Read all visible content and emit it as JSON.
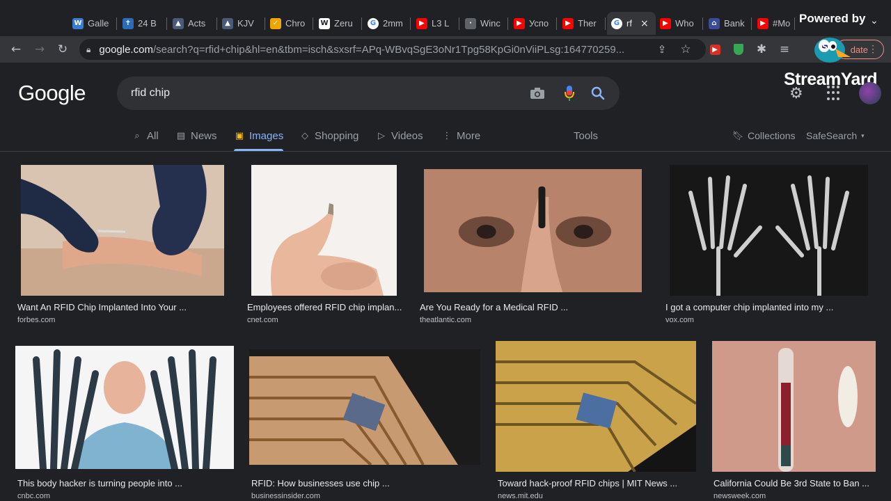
{
  "browser": {
    "tabs": [
      {
        "label": "Galle",
        "favicon": "wordpress-icon",
        "color": "#3a7bd5",
        "glyph": "W"
      },
      {
        "label": "24 B",
        "favicon": "bible-cross-icon",
        "color": "#2a6cb8",
        "glyph": "✝"
      },
      {
        "label": "Acts",
        "favicon": "bible-app-icon",
        "color": "#4a5a7a",
        "glyph": "▲"
      },
      {
        "label": "KJV",
        "favicon": "bible-app-icon",
        "color": "#4a5a7a",
        "glyph": "▲"
      },
      {
        "label": "Chro",
        "favicon": "check-app-icon",
        "color": "#f0a500",
        "glyph": "✓"
      },
      {
        "label": "Zeru",
        "favicon": "wikipedia-icon",
        "color": "#ffffff",
        "glyph": "W"
      },
      {
        "label": "2mm",
        "favicon": "google-icon",
        "color": "#ffffff",
        "glyph": "G"
      },
      {
        "label": "L3 L",
        "favicon": "youtube-icon",
        "color": "#ff0000",
        "glyph": "▶"
      },
      {
        "label": "Winc",
        "favicon": "dots-icon",
        "color": "#5f6368",
        "glyph": "·"
      },
      {
        "label": "Успо",
        "favicon": "youtube-icon",
        "color": "#ff0000",
        "glyph": "▶"
      },
      {
        "label": "Ther",
        "favicon": "youtube-icon",
        "color": "#ff0000",
        "glyph": "▶"
      },
      {
        "label": "rf",
        "favicon": "google-icon",
        "color": "#ffffff",
        "glyph": "G",
        "active": true
      },
      {
        "label": "Who",
        "favicon": "youtube-icon",
        "color": "#ff0000",
        "glyph": "▶"
      },
      {
        "label": "Bank",
        "favicon": "bank-icon",
        "color": "#3c4a9a",
        "glyph": "⌂"
      },
      {
        "label": "#Mo",
        "favicon": "youtube-icon",
        "color": "#ff0000",
        "glyph": "▶"
      }
    ],
    "url_host": "google.com",
    "url_path": "/search?q=rfid+chip&hl=en&tbm=isch&sxsrf=APq-WBvqSgE3oNr1Tpg58KpGi0nViiPLsg:164770259...",
    "update_label": "date"
  },
  "overlay": {
    "powered_by": "Powered by",
    "streamyard": "StreamYard"
  },
  "google": {
    "logo": "Google",
    "query": "rfid chip",
    "nav": [
      {
        "label": "All",
        "icon": "search-icon",
        "glyph": "⌕"
      },
      {
        "label": "News",
        "icon": "news-icon",
        "glyph": "▤"
      },
      {
        "label": "Images",
        "icon": "images-icon",
        "glyph": "▣",
        "active": true
      },
      {
        "label": "Shopping",
        "icon": "tag-icon",
        "glyph": "◇"
      },
      {
        "label": "Videos",
        "icon": "video-icon",
        "glyph": "▷"
      },
      {
        "label": "More",
        "icon": "more-icon",
        "glyph": "⋮"
      }
    ],
    "tools": "Tools",
    "collections": "Collections",
    "safesearch": "SafeSearch"
  },
  "results": [
    {
      "caption": "Want An RFID Chip Implanted Into Your ...",
      "source": "forbes.com",
      "art": "gloves"
    },
    {
      "caption": "Employees offered RFID chip implan...",
      "source": "cnet.com",
      "art": "fingers"
    },
    {
      "caption": "Are You Ready for a Medical RFID ...",
      "source": "theatlantic.com",
      "art": "face"
    },
    {
      "caption": "I got a computer chip implanted into my ...",
      "source": "vox.com",
      "art": "xray"
    },
    {
      "caption": "This body hacker is turning people into ...",
      "source": "cnbc.com",
      "art": "hacker"
    },
    {
      "caption": "RFID: How businesses use chip ...",
      "source": "businessinsider.com",
      "art": "circuit"
    },
    {
      "caption": "Toward hack-proof RFID chips | MIT News ...",
      "source": "news.mit.edu",
      "art": "circuit2"
    },
    {
      "caption": "California Could Be 3rd State to Ban ...",
      "source": "newsweek.com",
      "art": "capsule"
    }
  ]
}
